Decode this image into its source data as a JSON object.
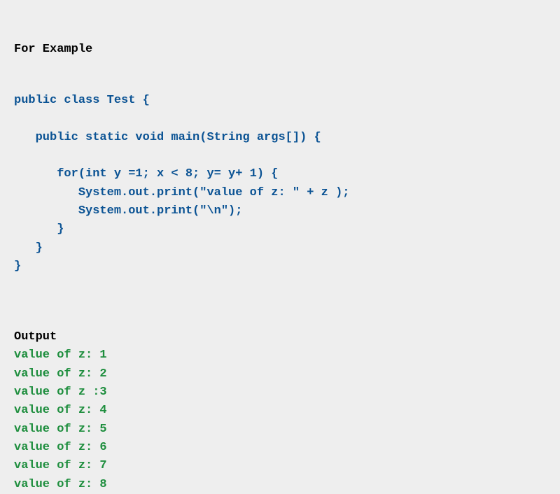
{
  "example_heading": "For Example",
  "code": {
    "l1": "public class Test {",
    "l2": "",
    "l3": "   public static void main(String args[]) {",
    "l4": "",
    "l5": "      for(int y =1; x < 8; y= y+ 1) {",
    "l6": "         System.out.print(\"value of z: \" + z );",
    "l7": "         System.out.print(\"\\n\");",
    "l8": "      }",
    "l9": "   }",
    "l10": "}"
  },
  "output_heading": "Output",
  "output": {
    "l1": "value of z: 1",
    "l2": "value of z: 2",
    "l3": "value of z :3",
    "l4": "value of z: 4",
    "l5": "value of z: 5",
    "l6": "value of z: 6",
    "l7": "value of z: 7",
    "l8": "value of z: 8"
  }
}
